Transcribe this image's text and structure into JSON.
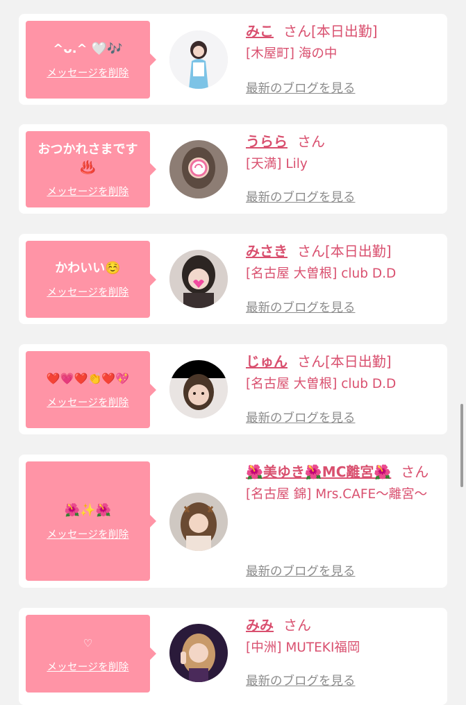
{
  "items": [
    {
      "message": "^ᴗ.^ 🤍🎶",
      "delete_label": "メッセージを削除",
      "name": "みこ",
      "honorific": "さん",
      "status": "[本日出勤]",
      "location": "[木屋町] 海の中",
      "blog_link": "最新のブログを見る",
      "avatar_icon": "avatar-photo"
    },
    {
      "message": "おつかれさまです♨️",
      "delete_label": "メッセージを削除",
      "name": "うらら",
      "honorific": "さん",
      "status": "",
      "location": "[天満] Lily",
      "blog_link": "最新のブログを見る",
      "avatar_icon": "avatar-photo"
    },
    {
      "message": "かわいい☺️",
      "delete_label": "メッセージを削除",
      "name": "みさき",
      "honorific": "さん",
      "status": "[本日出勤]",
      "location": "[名古屋 大曽根] club D.D",
      "blog_link": "最新のブログを見る",
      "avatar_icon": "avatar-photo"
    },
    {
      "message": "❤️💗❤️👏❤️💖",
      "delete_label": "メッセージを削除",
      "name": "じゅん",
      "honorific": "さん",
      "status": "[本日出勤]",
      "location": "[名古屋 大曽根] club D.D",
      "blog_link": "最新のブログを見る",
      "avatar_icon": "avatar-photo"
    },
    {
      "message": "🌺✨🌺",
      "delete_label": "メッセージを削除",
      "name": "🌺美ゆき🌺MC離宮🌺",
      "honorific": "さん",
      "status": "",
      "location": "[名古屋 錦] Mrs.CAFE～離宮～",
      "blog_link": "最新のブログを見る",
      "avatar_icon": "avatar-photo"
    },
    {
      "message": "♡",
      "delete_label": "メッセージを削除",
      "name": "みみ",
      "honorific": "さん",
      "status": "",
      "location": "[中洲] MUTEKI福岡",
      "blog_link": "最新のブログを見る",
      "avatar_icon": "avatar-photo"
    }
  ],
  "colors": {
    "bubble": "#ff94a6",
    "accent": "#d9506f",
    "link_gray": "#8c8c8c",
    "background": "#f2f2f2"
  }
}
